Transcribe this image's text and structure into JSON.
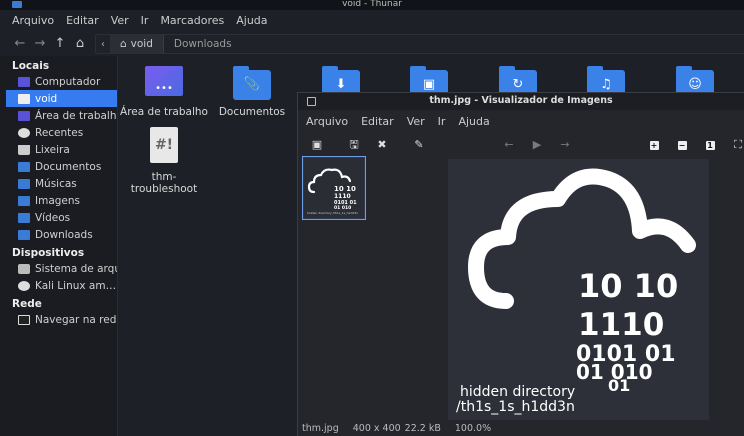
{
  "thunar": {
    "title": "void - Thunar",
    "menu": [
      "Arquivo",
      "Editar",
      "Ver",
      "Ir",
      "Marcadores",
      "Ajuda"
    ],
    "path": {
      "home": "void",
      "current": "Downloads"
    }
  },
  "sidebar": {
    "sections": [
      {
        "title": "Locais",
        "items": [
          {
            "label": "Computador",
            "icon": "computer-icon"
          },
          {
            "label": "void",
            "icon": "home-icon",
            "selected": true
          },
          {
            "label": "Área de trabalho",
            "icon": "desktop-icon"
          },
          {
            "label": "Recentes",
            "icon": "recent-icon"
          },
          {
            "label": "Lixeira",
            "icon": "trash-icon"
          },
          {
            "label": "Documentos",
            "icon": "folder-icon"
          },
          {
            "label": "Músicas",
            "icon": "folder-icon"
          },
          {
            "label": "Imagens",
            "icon": "folder-icon"
          },
          {
            "label": "Vídeos",
            "icon": "folder-icon"
          },
          {
            "label": "Downloads",
            "icon": "folder-icon"
          }
        ]
      },
      {
        "title": "Dispositivos",
        "items": [
          {
            "label": "Sistema de arqu…",
            "icon": "disk-icon"
          },
          {
            "label": "Kali Linux am…",
            "icon": "disc-icon",
            "eject": true
          }
        ]
      },
      {
        "title": "Rede",
        "items": [
          {
            "label": "Navegar na rede",
            "icon": "network-icon"
          }
        ]
      }
    ]
  },
  "files": [
    {
      "name": "Área de trabalho",
      "icon": "desktop-folder-icon"
    },
    {
      "name": "Documentos",
      "icon": "documents-folder-icon"
    },
    {
      "name": "",
      "icon": "downloads-folder-icon"
    },
    {
      "name": "",
      "icon": "pictures-folder-icon"
    },
    {
      "name": "",
      "icon": "public-folder-icon"
    },
    {
      "name": "",
      "icon": "music-folder-icon"
    },
    {
      "name": "",
      "icon": "users-folder-icon"
    },
    {
      "name": "thm-troubleshoot",
      "icon": "script-file-icon"
    }
  ],
  "viewer": {
    "title": "thm.jpg - Visualizador de Imagens",
    "menu": [
      "Arquivo",
      "Editar",
      "Ver",
      "Ir",
      "Ajuda"
    ],
    "image_text": {
      "binary_line1": "10  10",
      "binary_line2": "1110",
      "binary_line3": "0101  01",
      "binary_line4": "01      010",
      "binary_line5": "01",
      "caption_line1": "hidden directory",
      "caption_line2": "/th1s_1s_h1dd3n"
    },
    "thumbnail_caption": "hidden directory /th1s_1s_h1dd3n",
    "status": {
      "filename": "thm.jpg",
      "dimensions": "400 x 400",
      "size": "22.2 kB",
      "zoom": "100.0%"
    }
  }
}
